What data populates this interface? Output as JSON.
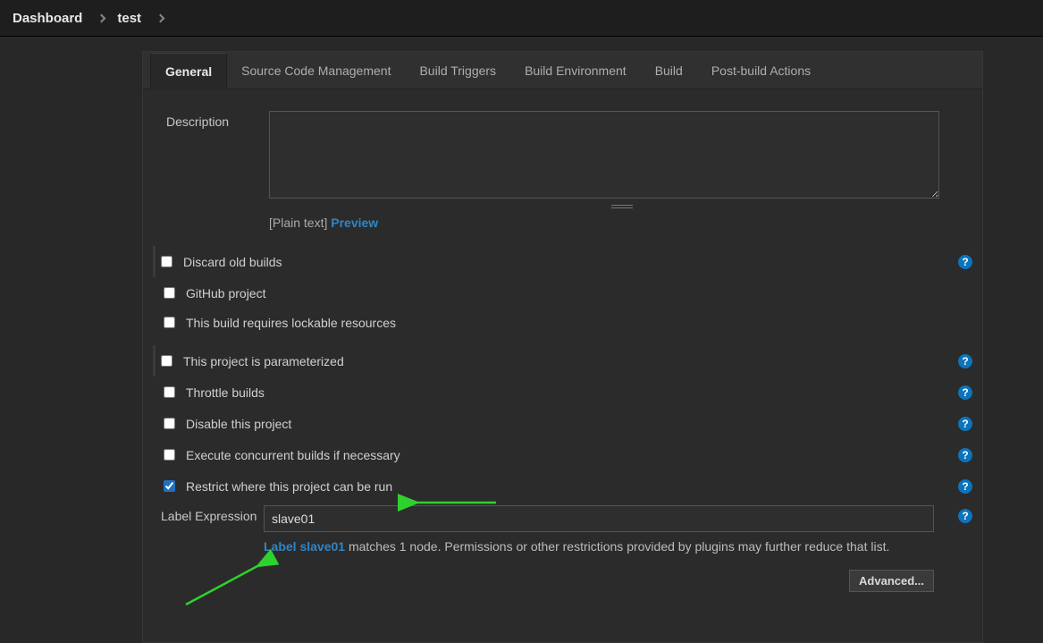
{
  "breadcrumb": {
    "dashboard": "Dashboard",
    "project": "test"
  },
  "tabs": {
    "general": "General",
    "scm": "Source Code Management",
    "triggers": "Build Triggers",
    "env": "Build Environment",
    "build": "Build",
    "post": "Post-build Actions"
  },
  "form": {
    "description_label": "Description",
    "description_value": "",
    "plain_text": "[Plain text] ",
    "preview": "Preview"
  },
  "options": {
    "discard": "Discard old builds",
    "github": "GitHub project",
    "lockable": "This build requires lockable resources",
    "param": "This project is parameterized",
    "throttle": "Throttle builds",
    "disable": "Disable this project",
    "concurrent": "Execute concurrent builds if necessary",
    "restrict": "Restrict where this project can be run"
  },
  "label_expr": {
    "label": "Label Expression",
    "value": "slave01",
    "status_link": "Label slave01",
    "status_rest": " matches 1 node. Permissions or other restrictions provided by plugins may further reduce that list."
  },
  "buttons": {
    "advanced": "Advanced..."
  },
  "icons": {
    "help_glyph": "?"
  }
}
